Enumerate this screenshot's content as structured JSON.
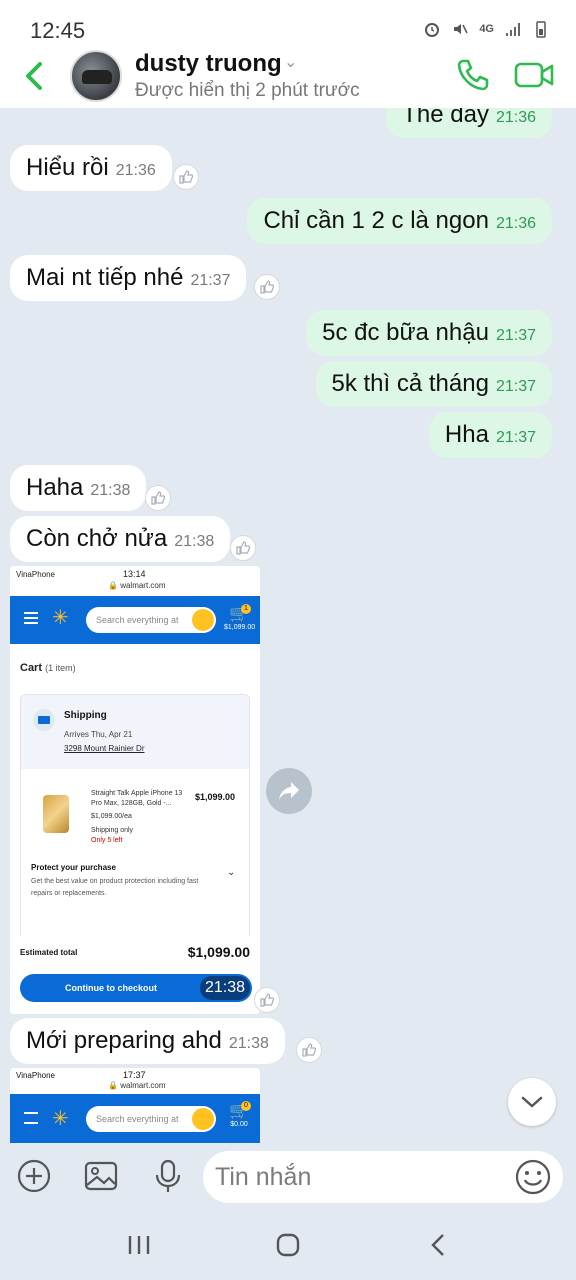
{
  "status_bar": {
    "time": "12:45",
    "network": "4G"
  },
  "header": {
    "contact_name": "dusty truong",
    "presence": "Được hiển thị 2 phút trước"
  },
  "messages": [
    {
      "dir": "out",
      "text": "The day",
      "time": "21:36"
    },
    {
      "dir": "in",
      "text": "Hiểu rồi",
      "time": "21:36"
    },
    {
      "dir": "out",
      "text": "Chỉ cần 1 2 c là ngon",
      "time": "21:36"
    },
    {
      "dir": "in",
      "text": "Mai nt tiếp nhé",
      "time": "21:37"
    },
    {
      "dir": "out",
      "text": "5c đc bữa nhậu",
      "time": "21:37"
    },
    {
      "dir": "out",
      "text": "5k thì cả tháng",
      "time": "21:37"
    },
    {
      "dir": "out",
      "text": "Hha",
      "time": "21:37"
    },
    {
      "dir": "in",
      "text": "Haha",
      "time": "21:38"
    },
    {
      "dir": "in",
      "text": "Còn chở nửa",
      "time": "21:38"
    },
    {
      "dir": "in",
      "text": "Mới preparing ahd",
      "time": "21:38"
    }
  ],
  "image_message": {
    "time": "21:38",
    "status_carrier": "VinaPhone",
    "status_clock": "13:14",
    "url": "walmart.com",
    "search_placeholder": "Search everything at",
    "cart_count": "1",
    "cart_total_header": "$1,099.00",
    "cart_title": "Cart",
    "cart_items": "(1 item)",
    "shipping_title": "Shipping",
    "arrives": "Arrives Thu, Apr 21",
    "address": "3298 Mount Rainier Dr",
    "product_desc": "Straight Talk Apple iPhone 13 Pro Max, 128GB, Gold -...",
    "product_price": "$1,099.00",
    "price_each": "$1,099.00/ea",
    "shipping_only": "Shipping only",
    "stock": "Only 5 left",
    "protect_title": "Protect your purchase",
    "protect_desc": "Get the best value on product protection including fast repairs or replacements.",
    "estimated_label": "Estimated total",
    "estimated_value": "$1,099.00",
    "checkout_label": "Continue to checkout"
  },
  "image_message_2": {
    "status_carrier": "VinaPhone",
    "status_clock": "17:37",
    "url": "walmart.com",
    "search_placeholder": "Search everything at",
    "cart_count": "0",
    "cart_total_header": "$0.00"
  },
  "composer": {
    "placeholder": "Tin nhắn"
  },
  "colors": {
    "accent": "#2dbb4e",
    "outgoing_bubble": "#ddf7e6",
    "incoming_bubble": "#ffffff",
    "chat_bg": "#e2e9f1"
  },
  "icons": [
    "back-icon",
    "phone-icon",
    "video-call-icon",
    "like-icon",
    "share-icon",
    "chevron-down-icon",
    "plus-icon",
    "image-icon",
    "mic-icon",
    "emoji-icon",
    "recent-apps-icon",
    "home-icon",
    "back-nav-icon"
  ]
}
